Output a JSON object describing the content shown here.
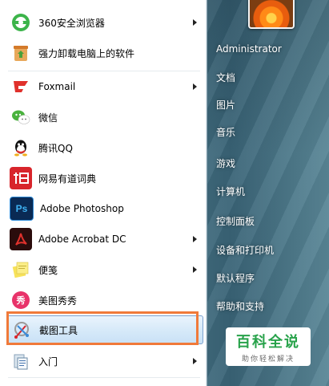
{
  "start_menu": {
    "left_items": [
      {
        "label": "360安全浏览器",
        "icon": "360-browser-icon",
        "has_arrow": true
      },
      {
        "label": "强力卸载电脑上的软件",
        "icon": "uninstall-icon",
        "has_arrow": false
      },
      {
        "label": "Foxmail",
        "icon": "foxmail-icon",
        "has_arrow": true
      },
      {
        "label": "微信",
        "icon": "wechat-icon",
        "has_arrow": false
      },
      {
        "label": "腾讯QQ",
        "icon": "qq-icon",
        "has_arrow": false
      },
      {
        "label": "网易有道词典",
        "icon": "youdao-icon",
        "has_arrow": false
      },
      {
        "label": "Adobe Photoshop",
        "icon": "photoshop-icon",
        "has_arrow": false
      },
      {
        "label": "Adobe Acrobat DC",
        "icon": "acrobat-icon",
        "has_arrow": true
      },
      {
        "label": "便笺",
        "icon": "sticky-notes-icon",
        "has_arrow": true
      },
      {
        "label": "美图秀秀",
        "icon": "meitu-icon",
        "has_arrow": false
      },
      {
        "label": "截图工具",
        "icon": "snipping-tool-icon",
        "has_arrow": false
      },
      {
        "label": "入门",
        "icon": "getting-started-icon",
        "has_arrow": true
      }
    ],
    "right_items": [
      "Administrator",
      "文档",
      "图片",
      "音乐",
      "游戏",
      "计算机",
      "控制面板",
      "设备和打印机",
      "默认程序",
      "帮助和支持"
    ]
  },
  "watermark": {
    "title": "百科全说",
    "subtitle": "助你轻松解决"
  },
  "colors": {
    "highlight_border": "#f07a3a",
    "watermark_green": "#27a24a"
  }
}
